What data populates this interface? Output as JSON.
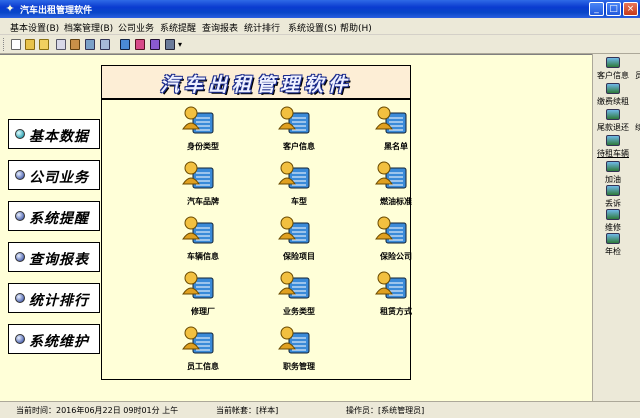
{
  "window": {
    "title": "汽车出租管理软件",
    "buttons": [
      "_",
      "□",
      "×"
    ]
  },
  "menu": [
    "基本设置(B)",
    "档案管理(B)",
    "公司业务",
    "系统提醒",
    "查询报表",
    "统计排行",
    "系统设置(S)",
    "帮助(H)"
  ],
  "toolbar": {
    "icons": [
      "new-icon",
      "open-icon",
      "save-icon",
      "print-icon",
      "search-icon",
      "settings-icon",
      "calc-icon",
      "globe-icon",
      "user-icon",
      "book-icon",
      "dropdown-icon"
    ],
    "overflow": "▾"
  },
  "sidebar": [
    {
      "label": "基本数据",
      "active": true
    },
    {
      "label": "公司业务",
      "active": false
    },
    {
      "label": "系统提醒",
      "active": false
    },
    {
      "label": "查询报表",
      "active": false
    },
    {
      "label": "统计排行",
      "active": false
    },
    {
      "label": "系统维护",
      "active": false
    }
  ],
  "panel": {
    "banner": "汽车出租管理软件",
    "items": [
      "身份类型",
      "客户信息",
      "黑名单",
      "汽车品牌",
      "车型",
      "燃油标准",
      "车辆信息",
      "保险项目",
      "保险公司",
      "修理厂",
      "业务类型",
      "租赁方式",
      "员工信息",
      "职务管理"
    ]
  },
  "rightbar": {
    "items": [
      "客户信息",
      "缴费续租",
      "尾款退还",
      "待租车辆",
      "加油",
      "丢诉",
      "维修",
      "年检"
    ],
    "cut": [
      "员",
      "",
      "续",
      "",
      "",
      "",
      "",
      ""
    ]
  },
  "status": {
    "time": "当前时间：2016年06月22日 09时01分 上午",
    "account": "当前帐套：[样本]",
    "operator": "操作员：[系统管理员]"
  }
}
